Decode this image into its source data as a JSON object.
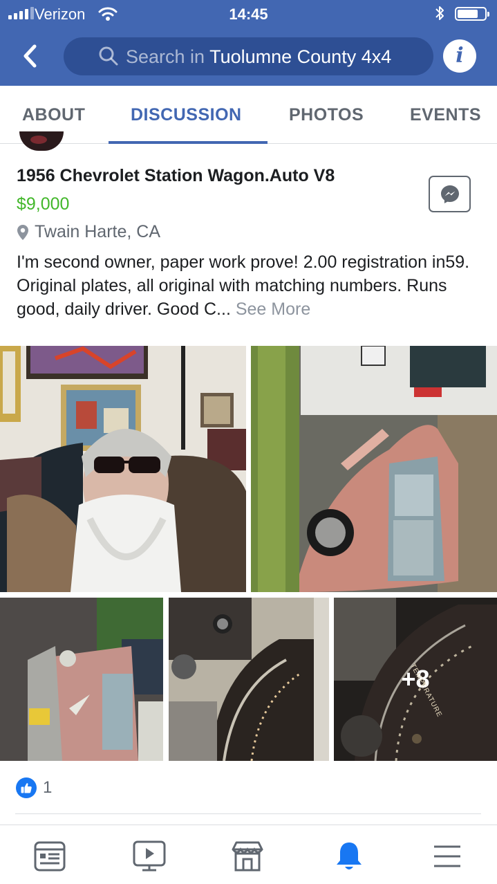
{
  "status_bar": {
    "carrier": "Verizon",
    "time": "14:45",
    "battery_level": 0.75
  },
  "header": {
    "search_placeholder": "Search in",
    "search_value": "Tuolumne County 4x4",
    "info_label": "i"
  },
  "tabs": [
    {
      "label": "ABOUT",
      "active": false
    },
    {
      "label": "DISCUSSION",
      "active": true
    },
    {
      "label": "PHOTOS",
      "active": false
    },
    {
      "label": "EVENTS",
      "active": false
    }
  ],
  "post": {
    "title": "1956 Chevrolet Station Wagon.Auto V8",
    "price": "$9,000",
    "location": "Twain Harte, CA",
    "body": "I'm second owner, paper work prove! 2.00 registration in59. Original plates, all original with matching numbers. Runs good, daily driver. Good C...",
    "see_more": "See More",
    "photos": [
      {
        "name": "photo-man-selfie",
        "icon": "bearded-man-photo"
      },
      {
        "name": "photo-wagon-side",
        "icon": "pink-station-wagon-photo"
      },
      {
        "name": "photo-wagon-front",
        "icon": "wagon-front-photo"
      },
      {
        "name": "photo-dashboard",
        "icon": "dashboard-photo"
      },
      {
        "name": "photo-speedometer",
        "icon": "speedometer-photo"
      }
    ],
    "more_photos_label": "+8",
    "speedometer_label": "TEMPERATURE",
    "reactions": {
      "like_count": "1"
    }
  },
  "bottom_nav": [
    {
      "name": "news-feed",
      "icon": "news-feed-icon",
      "active": false
    },
    {
      "name": "watch",
      "icon": "video-play-icon",
      "active": false
    },
    {
      "name": "marketplace",
      "icon": "marketplace-store-icon",
      "active": false
    },
    {
      "name": "notifications",
      "icon": "bell-icon",
      "active": true
    },
    {
      "name": "menu",
      "icon": "hamburger-menu-icon",
      "active": false
    }
  ],
  "colors": {
    "brand_blue": "#4267b2",
    "search_pill": "#2e4f94",
    "price_green": "#42b72a",
    "secondary_text": "#606770",
    "like_blue": "#1877f2",
    "nav_active": "#1877f2",
    "nav_inactive": "#606770"
  }
}
